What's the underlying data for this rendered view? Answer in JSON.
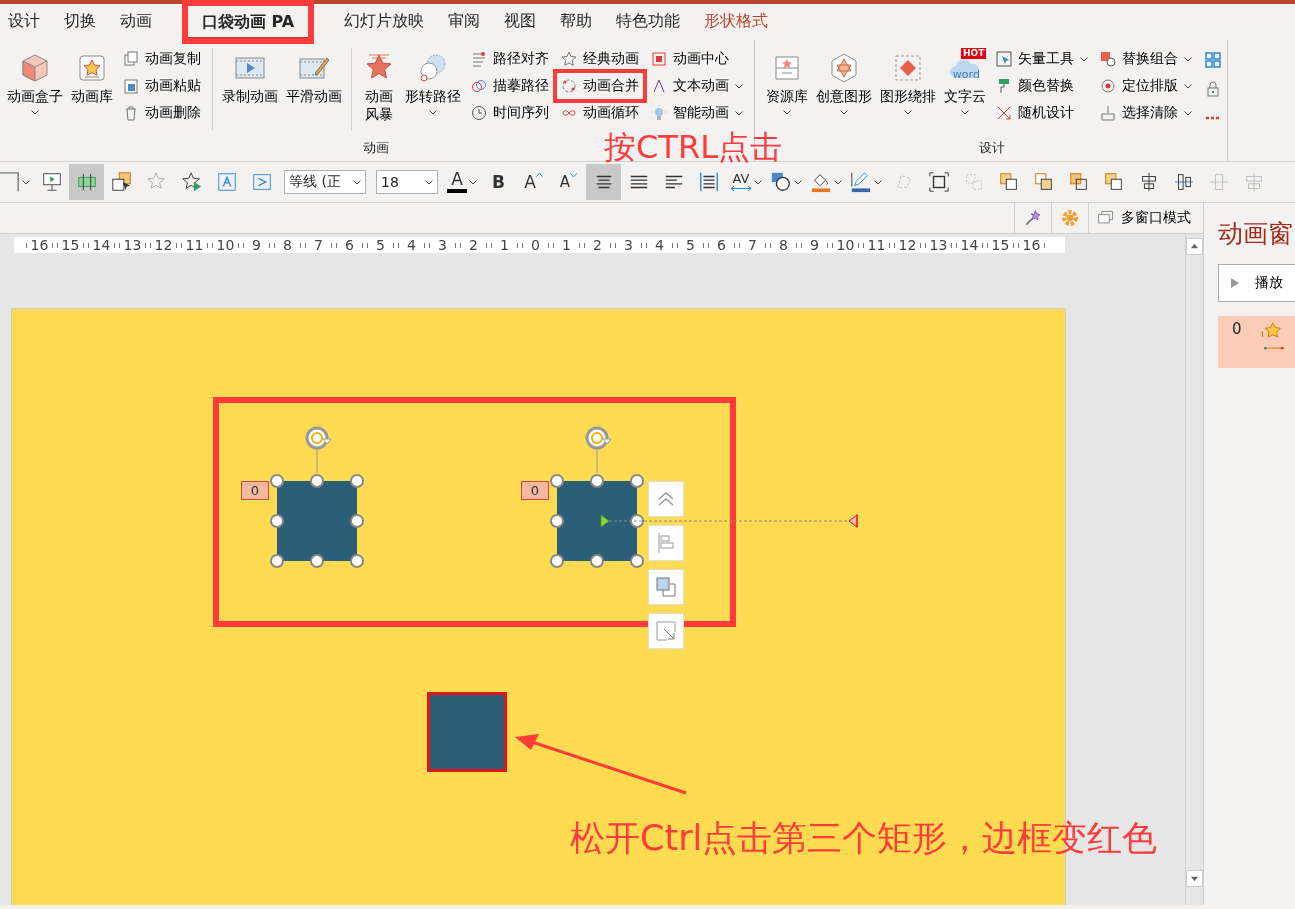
{
  "tabs": [
    {
      "label": "设计",
      "selected": false,
      "contextual": false
    },
    {
      "label": "切换",
      "selected": false,
      "contextual": false
    },
    {
      "label": "动画",
      "selected": false,
      "contextual": false
    },
    {
      "label": "口袋动画 PA",
      "selected": true,
      "contextual": false,
      "annotated": true
    },
    {
      "label": "幻灯片放映",
      "selected": false,
      "contextual": false
    },
    {
      "label": "审阅",
      "selected": false,
      "contextual": false
    },
    {
      "label": "视图",
      "selected": false,
      "contextual": false
    },
    {
      "label": "帮助",
      "selected": false,
      "contextual": false
    },
    {
      "label": "特色功能",
      "selected": false,
      "contextual": false
    },
    {
      "label": "形状格式",
      "selected": false,
      "contextual": true
    }
  ],
  "ribbon": {
    "groups": [
      {
        "label": "动画",
        "sections": [
          {
            "kind": "large",
            "items": [
              {
                "label": "动画盒子",
                "dropdown": true
              },
              {
                "label": "动画库",
                "dropdown": false
              }
            ]
          },
          {
            "kind": "small",
            "items": [
              {
                "label": "动画复制",
                "dropdown": false
              },
              {
                "label": "动画粘贴",
                "dropdown": false
              },
              {
                "label": "动画删除",
                "dropdown": false
              }
            ]
          },
          {
            "kind": "divider"
          },
          {
            "kind": "large",
            "items": [
              {
                "label": "录制动画",
                "dropdown": false
              },
              {
                "label": "平滑动画",
                "dropdown": false
              }
            ]
          },
          {
            "kind": "divider"
          },
          {
            "kind": "narrow",
            "items": [
              {
                "label": "动画风暴",
                "dropdown": false
              }
            ]
          },
          {
            "kind": "large",
            "items": [
              {
                "label": "形转路径",
                "dropdown": true
              }
            ]
          },
          {
            "kind": "small",
            "items": [
              {
                "label": "路径对齐",
                "dropdown": false
              },
              {
                "label": "描摹路径",
                "dropdown": false
              },
              {
                "label": "时间序列",
                "dropdown": false
              }
            ]
          },
          {
            "kind": "small",
            "items": [
              {
                "label": "经典动画",
                "dropdown": false
              },
              {
                "label": "动画合并",
                "dropdown": false,
                "annotated": true
              },
              {
                "label": "动画循环",
                "dropdown": false
              }
            ]
          },
          {
            "kind": "small",
            "items": [
              {
                "label": "动画中心",
                "dropdown": false
              },
              {
                "label": "文本动画",
                "dropdown": true
              },
              {
                "label": "智能动画",
                "dropdown": true
              }
            ]
          }
        ]
      },
      {
        "label": "设计",
        "sections": [
          {
            "kind": "large",
            "items": [
              {
                "label": "资源库",
                "dropdown": true
              },
              {
                "label": "创意图形",
                "dropdown": true
              },
              {
                "label": "图形绕排",
                "dropdown": true
              },
              {
                "label": "文字云",
                "dropdown": true,
                "badge": "HOT",
                "icon_text": "word"
              }
            ]
          },
          {
            "kind": "small",
            "items": [
              {
                "label": "矢量工具",
                "dropdown": true
              },
              {
                "label": "颜色替换",
                "dropdown": false
              },
              {
                "label": "随机设计",
                "dropdown": false
              }
            ]
          },
          {
            "kind": "small",
            "items": [
              {
                "label": "替换组合",
                "dropdown": true
              },
              {
                "label": "定位排版",
                "dropdown": true
              },
              {
                "label": "选择清除",
                "dropdown": true
              }
            ]
          },
          {
            "kind": "icons"
          }
        ]
      }
    ]
  },
  "format_toolbar": {
    "items": [
      {
        "kind": "icon",
        "selected": false,
        "dropdown": true
      },
      {
        "kind": "icon",
        "selected": false,
        "dropdown": false
      },
      {
        "kind": "icon",
        "selected": true,
        "dropdown": false
      },
      {
        "kind": "icon",
        "selected": false,
        "dropdown": false
      },
      {
        "kind": "icon",
        "selected": false,
        "dropdown": false
      },
      {
        "kind": "icon",
        "selected": false,
        "dropdown": false
      },
      {
        "kind": "icon",
        "selected": false,
        "dropdown": false
      },
      {
        "kind": "icon",
        "selected": false,
        "dropdown": false
      },
      {
        "kind": "font",
        "value": "等线 (正",
        "dropdown": true
      },
      {
        "kind": "size",
        "value": "18",
        "dropdown": true
      },
      {
        "kind": "color",
        "label": "A",
        "selected": false,
        "dropdown": true
      },
      {
        "kind": "bold",
        "label": "B",
        "selected": false,
        "dropdown": false
      },
      {
        "kind": "grow",
        "label": "A",
        "selected": false,
        "dropdown": false
      },
      {
        "kind": "shrink",
        "label": "A",
        "selected": false,
        "dropdown": false
      },
      {
        "kind": "icon",
        "selected": true,
        "dropdown": false
      },
      {
        "kind": "icon",
        "selected": false,
        "dropdown": false
      },
      {
        "kind": "icon",
        "selected": false,
        "dropdown": false
      },
      {
        "kind": "icon",
        "selected": false,
        "dropdown": false
      },
      {
        "kind": "spacing",
        "label": "AV",
        "selected": false,
        "dropdown": true
      },
      {
        "kind": "icon",
        "selected": false,
        "dropdown": true
      },
      {
        "kind": "icon",
        "selected": false,
        "dropdown": true
      },
      {
        "kind": "icon",
        "selected": false,
        "dropdown": true
      },
      {
        "kind": "icon",
        "selected": false,
        "dropdown": false
      },
      {
        "kind": "icon",
        "selected": false,
        "dropdown": false
      },
      {
        "kind": "icon",
        "selected": false,
        "dropdown": false
      },
      {
        "kind": "icon",
        "selected": false,
        "dropdown": false
      },
      {
        "kind": "icon",
        "selected": false,
        "dropdown": false
      },
      {
        "kind": "icon",
        "selected": false,
        "dropdown": false
      },
      {
        "kind": "icon",
        "selected": false,
        "dropdown": false
      },
      {
        "kind": "icon",
        "selected": false,
        "dropdown": false
      },
      {
        "kind": "icon",
        "selected": false,
        "dropdown": false
      },
      {
        "kind": "icon",
        "selected": false,
        "dropdown": false
      },
      {
        "kind": "icon",
        "selected": false,
        "dropdown": false
      }
    ]
  },
  "view_bar": {
    "multi_window": "多窗口模式"
  },
  "ruler": {
    "labels": [
      "16",
      "15",
      "14",
      "13",
      "12",
      "11",
      "10",
      "9",
      "8",
      "7",
      "6",
      "5",
      "4",
      "3",
      "2",
      "1",
      "0",
      "1",
      "2",
      "3",
      "4",
      "5",
      "6",
      "7",
      "8",
      "9",
      "10",
      "11",
      "12",
      "13",
      "14",
      "15",
      "16"
    ]
  },
  "slide": {
    "shapes": [
      {
        "badge": "0",
        "selected": true,
        "motion_path": false,
        "highlighted": false
      },
      {
        "badge": "0",
        "selected": true,
        "motion_path": true,
        "highlighted": false
      },
      {
        "selected": false,
        "motion_path": false,
        "highlighted": true
      }
    ]
  },
  "annotations": {
    "ctrl_click_note": "按CTRL点击",
    "release_note": "松开Ctrl点击第三个矩形，边框变红色"
  },
  "animation_pane": {
    "title": "动画窗",
    "play_button": "播放",
    "items": [
      {
        "number": "0",
        "selected": true
      }
    ]
  }
}
